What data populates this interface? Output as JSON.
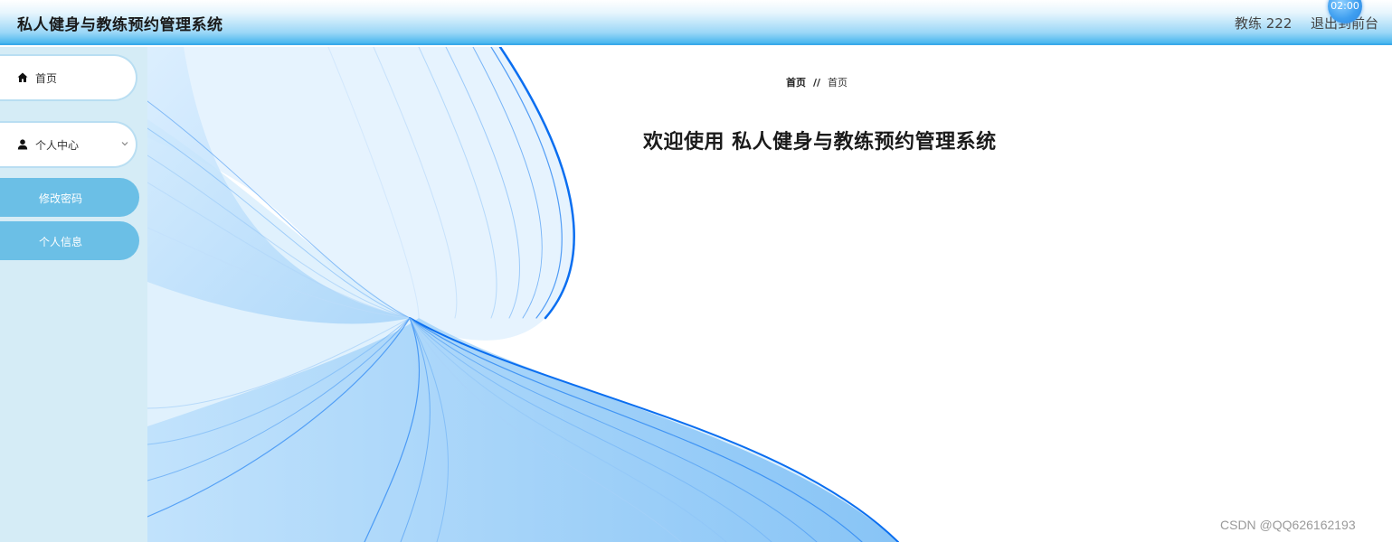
{
  "header": {
    "title": "私人健身与教练预约管理系统",
    "user_label": "教练 222",
    "logout_label": "退出到前台",
    "timer": "02:00"
  },
  "sidebar": {
    "items": [
      {
        "label": "首页",
        "icon": "home-icon"
      },
      {
        "label": "个人中心",
        "icon": "user-icon",
        "expanded": true,
        "children": [
          {
            "label": "修改密码"
          },
          {
            "label": "个人信息"
          }
        ]
      }
    ]
  },
  "main": {
    "breadcrumb": {
      "home": "首页",
      "separator": "//",
      "current": "首页"
    },
    "welcome": "欢迎使用 私人健身与教练预约管理系统"
  },
  "watermark": "CSDN @QQ626162193",
  "colors": {
    "header_accent": "#47b6ee",
    "sidebar_bg": "#d5ecf6",
    "submenu_bg": "#6bbfe6",
    "art_blue": "#0a6ef0"
  }
}
